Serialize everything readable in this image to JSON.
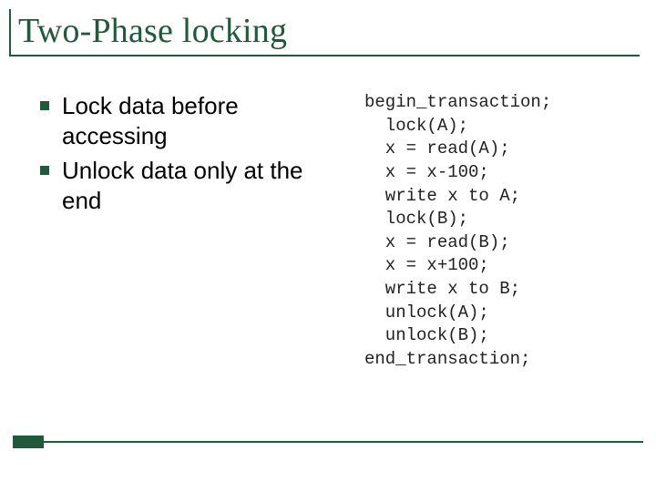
{
  "title": "Two-Phase locking",
  "bullets": [
    "Lock data before accessing",
    "Unlock data only at  the end"
  ],
  "code": {
    "lines": [
      "begin_transaction;",
      "  lock(A);",
      "  x = read(A);",
      "  x = x-100;",
      "  write x to A;",
      "  lock(B);",
      "  x = read(B);",
      "  x = x+100;",
      "  write x to B;",
      "  unlock(A);",
      "  unlock(B);",
      "end_transaction;"
    ]
  }
}
